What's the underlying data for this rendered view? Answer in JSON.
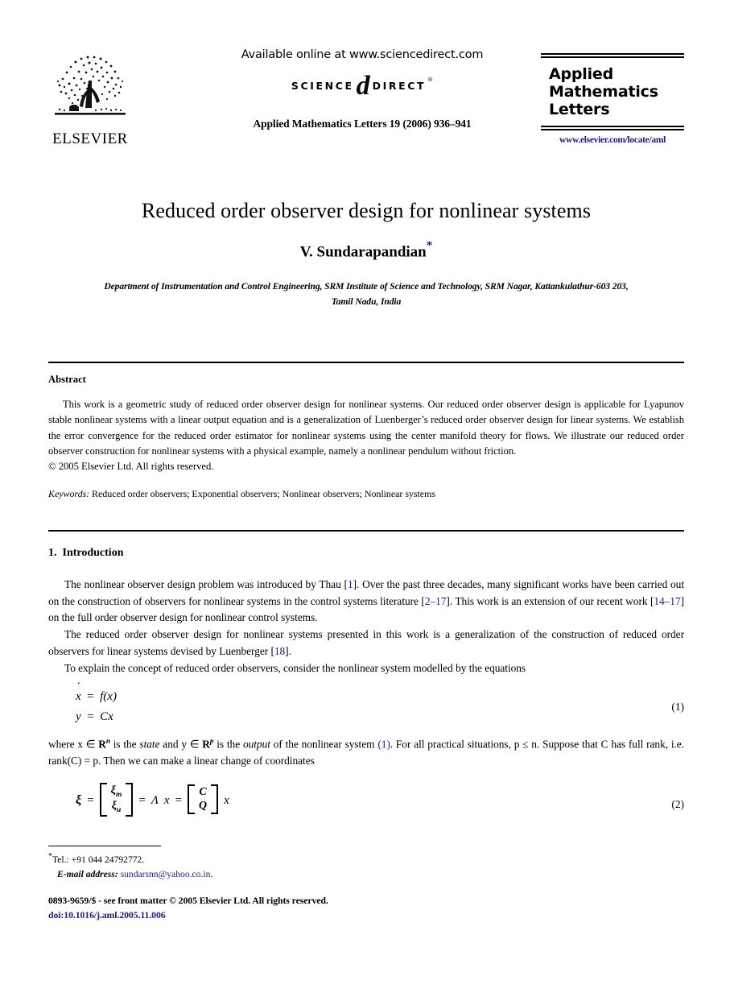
{
  "header": {
    "publisher_name": "ELSEVIER",
    "publisher_logo_icon": "elsevier-tree-icon",
    "available_online": "Available online at www.sciencedirect.com",
    "sciencedirect_left": "SCIENCE",
    "sciencedirect_at": "d",
    "sciencedirect_right": "DIRECT",
    "sciencedirect_mark": "®",
    "journal_reference": "Applied Mathematics Letters 19 (2006) 936–941",
    "journal_box": {
      "line1": "Applied",
      "line2": "Mathematics",
      "line3": "Letters",
      "url": "www.elsevier.com/locate/aml"
    }
  },
  "title_block": {
    "title": "Reduced order observer design for nonlinear systems",
    "author": "V. Sundarapandian",
    "author_footnote_marker": "*",
    "affiliation_line1": "Department of Instrumentation and Control Engineering, SRM Institute of Science and Technology, SRM Nagar, Kattankulathur-603 203,",
    "affiliation_line2": "Tamil Nadu, India"
  },
  "abstract": {
    "heading": "Abstract",
    "text": "This work is a geometric study of reduced order observer design for nonlinear systems. Our reduced order observer design is applicable for Lyapunov stable nonlinear systems with a linear output equation and is a generalization of Luenberger’s reduced order observer design for linear systems. We establish the error convergence for the reduced order estimator for nonlinear systems using the center manifold theory for flows. We illustrate our reduced order observer construction for nonlinear systems with a physical example, namely a nonlinear pendulum without friction.",
    "copyright": "© 2005 Elsevier Ltd. All rights reserved.",
    "keywords_label": "Keywords:",
    "keywords_text": " Reduced order observers; Exponential observers; Nonlinear observers; Nonlinear systems"
  },
  "introduction": {
    "number": "1.",
    "heading": "Introduction",
    "para1_a": "The nonlinear observer design problem was introduced by Thau [",
    "para1_cite1": "1",
    "para1_b": "]. Over the past three decades, many significant works have been carried out on the construction of observers for nonlinear systems in the control systems literature [",
    "para1_cite2": "2–17",
    "para1_c": "]. This work is an extension of our recent work [",
    "para1_cite3": "14–17",
    "para1_d": "] on the full order observer design for nonlinear control systems.",
    "para2_a": "The reduced order observer design for nonlinear systems presented in this work is a generalization of the construction of reduced order observers for linear systems devised by Luenberger [",
    "para2_cite": "18",
    "para2_b": "].",
    "para3": "To explain the concept of reduced order observers, consider the nonlinear system modelled by the equations",
    "eq1": {
      "number": "(1)",
      "line1_lhs": "x",
      "line1_rel": "=",
      "line1_rhs": "f(x)",
      "line2_lhs": "y",
      "line2_rel": "=",
      "line2_rhs": "Cx"
    },
    "para4_a": "where x ∈ ",
    "para4_R1": "R",
    "para4_R1sup": "n",
    "para4_b": " is the ",
    "para4_state": "state",
    "para4_c": " and y ∈ ",
    "para4_R2": "R",
    "para4_R2sup": "p",
    "para4_d": " is the ",
    "para4_output": "output",
    "para4_e": " of the nonlinear system ",
    "para4_cite": "(1)",
    "para4_f": ". For all practical situations, p ≤ n. Suppose that C has full rank, i.e. rank(C) = p. Then we can make a linear change of coordinates",
    "eq2": {
      "number": "(2)",
      "xi": "ξ",
      "eq1": "=",
      "m_top": "ξ",
      "m_top_sub": "m",
      "m_bot": "ξ",
      "m_bot_sub": "u",
      "eq2": "=",
      "lambda": "Λ",
      "x1": "x",
      "eq3": "=",
      "c_top": "C",
      "c_bot": "Q",
      "x2": "x"
    }
  },
  "footer": {
    "tel_marker": "*",
    "tel": "Tel.: +91 044 24792772.",
    "email_label": "E-mail address:",
    "email": "sundarsnn@yahoo.co.in",
    "email_period": ".",
    "imprint": "0893-9659/$ - see front matter © 2005 Elsevier Ltd. All rights reserved.",
    "doi": "doi:10.1016/j.aml.2005.11.006"
  },
  "colors": {
    "link_blue": "#1a1a8c",
    "text_black": "#000000",
    "page_background": "#ffffff"
  }
}
